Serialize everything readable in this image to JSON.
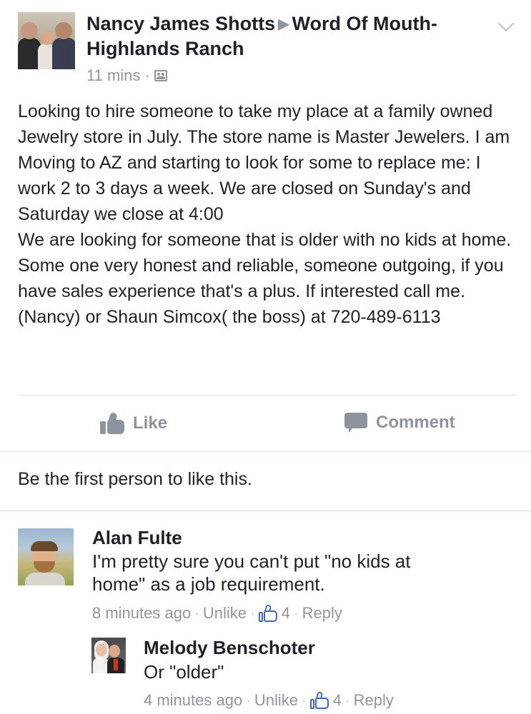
{
  "post": {
    "author": "Nancy James Shotts",
    "group": "Word Of Mouth-Highlands Ranch",
    "timestamp": "11 mins",
    "privacy_icon": "group-icon",
    "menu_icon": "chevron-down-icon",
    "text": "Looking to hire someone to take my place at a family owned Jewelry store in July. The store name is Master Jewelers. I am\nMoving to AZ and starting to look for some to replace me: I work 2 to 3 days a week. We are closed on Sunday's and Saturday we close at 4:00\nWe are looking for someone that is older with no kids at home. Some one very honest and reliable, someone outgoing, if you have sales experience that's a plus.  If interested call me. (Nancy) or Shaun Simcox( the boss) at 720-489-6113"
  },
  "actions": {
    "like_label": "Like",
    "comment_label": "Comment"
  },
  "likes_summary": "Be the first person to like this.",
  "comments": [
    {
      "name": "Alan Fulte",
      "text": "I'm pretty sure you can't put \"no kids at\nhome\" as a job requirement.",
      "time": "8 minutes ago",
      "unlike": "Unlike",
      "likes": "4",
      "reply": "Reply"
    },
    {
      "name": "Melody Benschoter",
      "text": "Or \"older\"",
      "time": "4 minutes ago",
      "unlike": "Unlike",
      "likes": "4",
      "reply": "Reply"
    }
  ],
  "colors": {
    "text": "#1d2129",
    "muted": "#90949c",
    "accent": "#4267b2",
    "divider": "#dddfe2"
  }
}
